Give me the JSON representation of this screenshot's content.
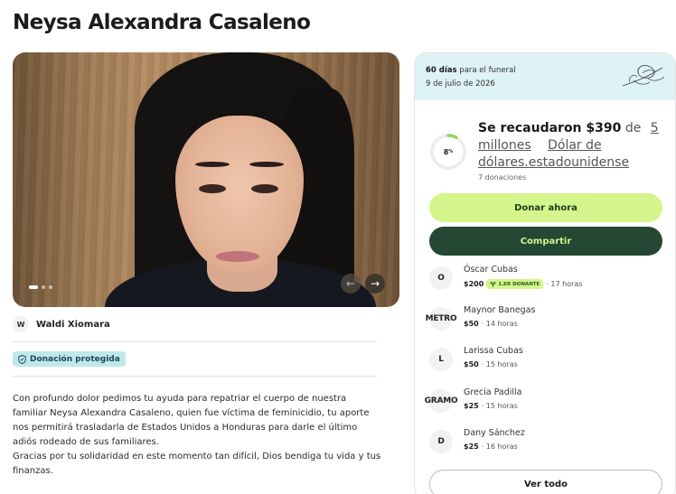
{
  "page": {
    "title": "Neysa Alexandra Casaleno"
  },
  "gallery": {
    "slide_count": 3,
    "active_slide": 1
  },
  "organizer": {
    "initial": "W",
    "name": "Waldi Xiomara"
  },
  "badge": {
    "label": "Donación protegida",
    "icon": "shield-icon"
  },
  "story": {
    "paragraph1": "Con profundo dolor pedimos tu ayuda para repatriar el cuerpo de nuestra familiar Neysa Alexandra Casaleno, quien fue víctima de feminicidio, tu aporte nos permitirá trasladarla de Estados Unidos a Honduras para darle el último adiós rodeado de sus familiares.",
    "paragraph2": "Gracias por tu solidaridad en este momento tan difícil, Dios bendiga tu vida y tus finanzas."
  },
  "funeral": {
    "days_bold": "60 días",
    "days_rest": " para el funeral",
    "date": "9 de julio de 2026"
  },
  "fundraiser": {
    "progress_percent": 8,
    "progress_label": "8",
    "progress_unit": "%",
    "raised_label": "Se recaudaron $390",
    "de": " de",
    "goal_amount": "5 millones",
    "goal_currency": "Dólar de dólares.estadounidense",
    "donations_count": "7 donaciones",
    "accent_color": "#d4f58b",
    "dark_color": "#244833"
  },
  "actions": {
    "donate": "Donar ahora",
    "share": "Compartir",
    "see_all": "Ver todo"
  },
  "donors": [
    {
      "initial": "O",
      "name": "Óscar Cubas",
      "amount": "$200",
      "badge": "1.ER DONANTE",
      "time": "· 17 horas"
    },
    {
      "initial": "METRO",
      "name": "Maynor Banegas",
      "amount": "$50",
      "badge": "",
      "time": "· 14 horas"
    },
    {
      "initial": "L",
      "name": "Larissa Cubas",
      "amount": "$50",
      "badge": "",
      "time": "· 15 horas"
    },
    {
      "initial": "GRAMO",
      "name": "Grecia Padilla",
      "amount": "$25",
      "badge": "",
      "time": "· 15 horas"
    },
    {
      "initial": "D",
      "name": "Dany Sánchez",
      "amount": "$25",
      "badge": "",
      "time": "· 16 horas"
    }
  ]
}
